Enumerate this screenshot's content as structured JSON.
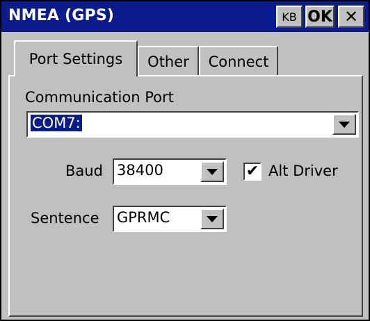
{
  "window": {
    "title": "NMEA (GPS)"
  },
  "title_buttons": {
    "kb": "KB",
    "ok": "OK",
    "close": "✕"
  },
  "tabs": [
    {
      "label": "Port Settings",
      "active": true
    },
    {
      "label": "Other",
      "active": false
    },
    {
      "label": "Connect",
      "active": false
    }
  ],
  "port": {
    "label": "Communication Port",
    "value": "COM7:"
  },
  "baud": {
    "label": "Baud",
    "value": "38400"
  },
  "alt_driver": {
    "label": "Alt Driver",
    "checked": true,
    "check_glyph": "✔"
  },
  "sentence": {
    "label": "Sentence",
    "value": "GPRMC"
  },
  "colors": {
    "titlebar": "#0a1b8e",
    "window_bg": "#c0c0c0"
  }
}
